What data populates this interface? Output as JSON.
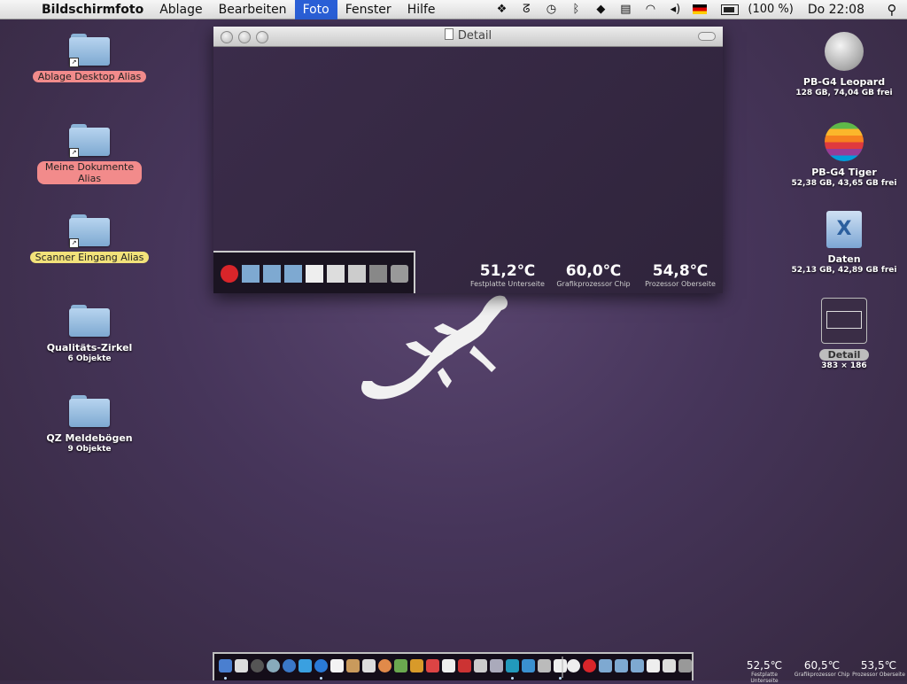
{
  "menubar": {
    "app_name": "Bildschirmfoto",
    "items": [
      "Ablage",
      "Bearbeiten",
      "Foto",
      "Fenster",
      "Hilfe"
    ],
    "active_item": "Foto",
    "status_icons": [
      "dropbox-icon",
      "sync-icon",
      "time-machine-icon",
      "bluetooth-icon",
      "launch-icon",
      "script-icon",
      "wifi-icon",
      "volume-icon",
      "flag-de-icon",
      "battery-icon"
    ],
    "battery_text": "(100 %)",
    "clock": "Do 22:08"
  },
  "desktop_left": [
    {
      "name": "Ablage Desktop Alias",
      "label_color": "red",
      "alias": true
    },
    {
      "name": "Meine Dokumente Alias",
      "label_color": "red",
      "alias": true
    },
    {
      "name": "Scanner Eingang Alias",
      "label_color": "yellow",
      "alias": true
    },
    {
      "name": "Qualitäts-Zirkel",
      "sub": "6 Objekte"
    },
    {
      "name": "QZ Meldebögen",
      "sub": "9 Objekte"
    }
  ],
  "desktop_right": [
    {
      "name": "PB-G4 Leopard",
      "sub": "128 GB, 74,04 GB frei"
    },
    {
      "name": "PB-G4 Tiger",
      "sub": "52,38 GB, 43,65 GB frei"
    },
    {
      "name": "Daten",
      "sub": "52,13 GB, 42,89 GB frei"
    },
    {
      "name": "Detail",
      "sub": "383 × 186"
    }
  ],
  "window": {
    "title": "Detail",
    "temps": [
      {
        "value": "51,2℃",
        "label": "Festplatte Unterseite"
      },
      {
        "value": "60,0℃",
        "label": "Grafikprozessor Chip"
      },
      {
        "value": "54,8℃",
        "label": "Prozessor Oberseite"
      }
    ]
  },
  "bottom_temps": [
    {
      "value": "52,5℃",
      "label": "Festplatte Unterseite"
    },
    {
      "value": "60,5℃",
      "label": "Grafikprozessor Chip"
    },
    {
      "value": "53,5℃",
      "label": "Prozessor Oberseite"
    }
  ],
  "colors": {
    "menu_active": "#2a5fd6",
    "label_red": "#f28b8b",
    "label_yellow": "#f2e27a"
  }
}
